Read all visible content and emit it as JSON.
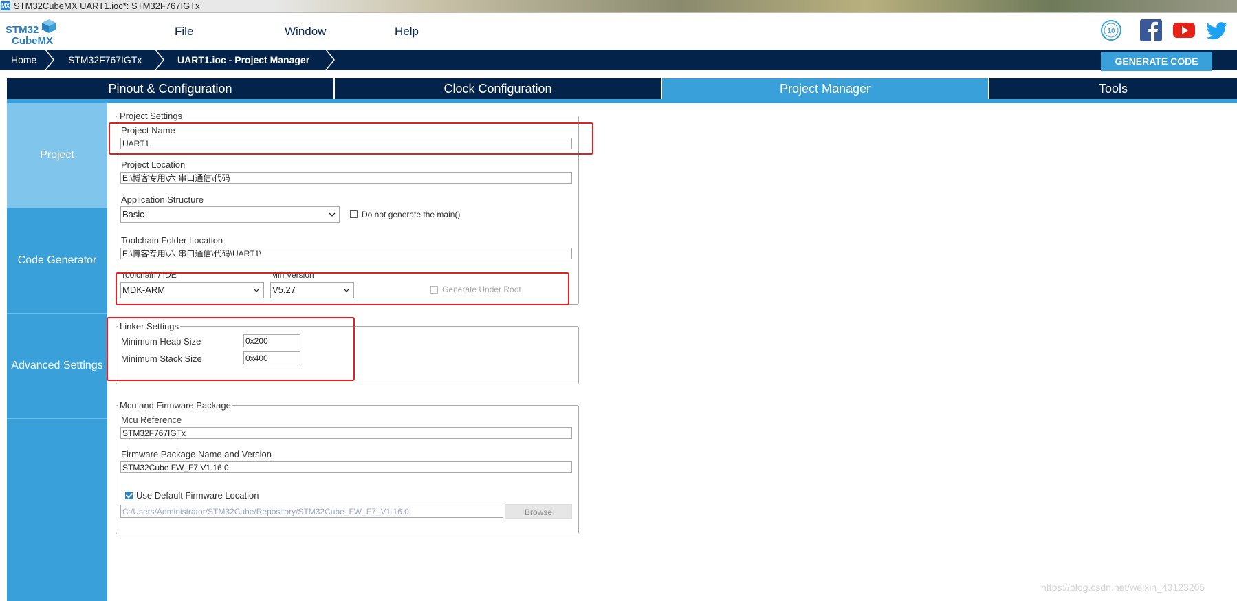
{
  "window": {
    "title": "STM32CubeMX UART1.ioc*: STM32F767IGTx",
    "app_icon": "MX"
  },
  "logo": {
    "line1": "STM32",
    "line2": "CubeMX"
  },
  "menu": [
    "File",
    "Window",
    "Help"
  ],
  "social": [
    "anniversary-icon",
    "facebook-icon",
    "youtube-icon",
    "twitter-icon"
  ],
  "social_text": {
    "anniversary": "10"
  },
  "breadcrumb": [
    "Home",
    "STM32F767IGTx",
    "UART1.ioc - Project Manager"
  ],
  "generate_label": "GENERATE CODE",
  "tabs": [
    "Pinout & Configuration",
    "Clock Configuration",
    "Project Manager",
    "Tools"
  ],
  "active_tab": "Project Manager",
  "sidebar": [
    "Project",
    "Code Generator",
    "Advanced Settings"
  ],
  "active_sidebar": "Project",
  "project_settings": {
    "legend": "Project Settings",
    "project_name_label": "Project Name",
    "project_name": "UART1",
    "project_location_label": "Project Location",
    "project_location": "E:\\博客专用\\六 串口通信\\代码",
    "app_structure_label": "Application Structure",
    "app_structure": "Basic",
    "no_main_label": "Do not generate the main()",
    "toolchain_folder_label": "Toolchain Folder Location",
    "toolchain_folder": "E:\\博客专用\\六 串口通信\\代码\\UART1\\",
    "toolchain_label": "Toolchain / IDE",
    "toolchain": "MDK-ARM",
    "min_version_label": "Min Version",
    "min_version": "V5.27",
    "gen_under_root_label": "Generate Under Root"
  },
  "linker_settings": {
    "legend": "Linker Settings",
    "heap_label": "Minimum Heap Size",
    "heap": "0x200",
    "stack_label": "Minimum Stack Size",
    "stack": "0x400"
  },
  "mcu_firmware": {
    "legend": "Mcu and Firmware Package",
    "mcu_ref_label": "Mcu Reference",
    "mcu_ref": "STM32F767IGTx",
    "fw_label": "Firmware Package Name and Version",
    "fw": "STM32Cube FW_F7 V1.16.0",
    "use_default_label": "Use Default Firmware Location",
    "fw_path": "C:/Users/Administrator/STM32Cube/Repository/STM32Cube_FW_F7_V1.16.0",
    "browse_label": "Browse"
  },
  "watermark": "https://blog.csdn.net/weixin_43123205",
  "colors": {
    "navy": "#03234b",
    "accent": "#3aa0d9",
    "highlight_box": "#e32020"
  }
}
